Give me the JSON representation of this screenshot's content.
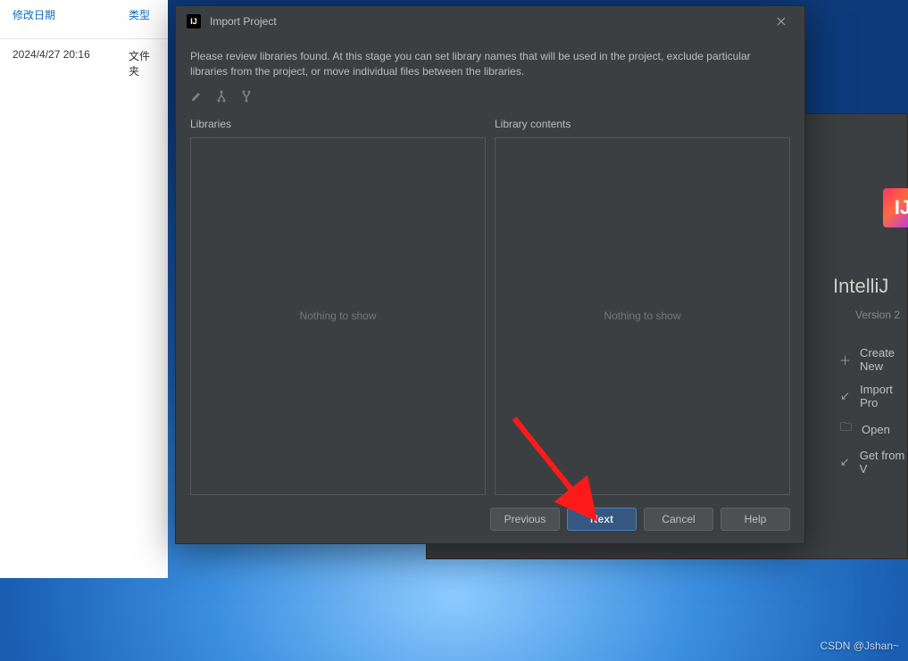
{
  "explorer": {
    "header_date": "修改日期",
    "header_type": "类型",
    "row_date": "2024/4/27 20:16",
    "row_type": "文件夹"
  },
  "welcome": {
    "logo_text": "IJ",
    "title": "IntelliJ",
    "version": "Version 2",
    "menu": {
      "create": "Create New",
      "import": "Import Pro",
      "open": "Open",
      "get": "Get from V"
    }
  },
  "dialog": {
    "logo_text": "IJ",
    "title": "Import Project",
    "instructions": "Please review libraries found. At this stage you can set library names that will be used in the project, exclude particular libraries from the project, or move individual files between the libraries.",
    "panel_left_label": "Libraries",
    "panel_right_label": "Library contents",
    "empty_text": "Nothing to show",
    "buttons": {
      "previous": "Previous",
      "next": "Next",
      "cancel": "Cancel",
      "help": "Help"
    }
  },
  "watermark": "CSDN @Jshan~"
}
